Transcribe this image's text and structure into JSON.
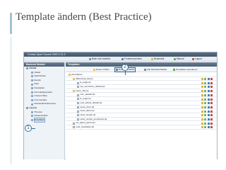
{
  "slide": {
    "title": "Template ändern (Best Practice)",
    "callouts": [
      "1",
      "2"
    ]
  },
  "app": {
    "title": "Contao Open Source CMS 2.11.3",
    "menu": [
      {
        "label": "Back end modules",
        "icon": "grid-icon",
        "color": "#7a8a99"
      },
      {
        "label": "Frontend preview",
        "icon": "preview-icon",
        "color": "#3f7fbf"
      },
      {
        "label": "Bookmark",
        "icon": "star-icon",
        "color": "#e2b33a"
      },
      {
        "label": "Manual",
        "icon": "help-icon",
        "color": "#5aa84a"
      },
      {
        "label": "Logout",
        "icon": "logout-icon",
        "color": "#c94a3a"
      }
    ],
    "sidebar": {
      "header": "Backend Module",
      "items": [
        {
          "label": "Inhalte",
          "type": "group"
        },
        {
          "label": "Artikel",
          "type": "item"
        },
        {
          "label": "Nachrichten",
          "type": "item"
        },
        {
          "label": "Events",
          "type": "item"
        },
        {
          "label": "FAQ",
          "type": "item"
        },
        {
          "label": "Newsletter",
          "type": "item"
        },
        {
          "label": "Formulargenerator",
          "type": "item"
        },
        {
          "label": "Content Slice",
          "type": "item"
        },
        {
          "label": "Kommentare",
          "type": "item"
        },
        {
          "label": "Download Dokumente",
          "type": "item"
        },
        {
          "label": "Layout",
          "type": "group"
        },
        {
          "label": "Themes",
          "type": "item"
        },
        {
          "label": "Seitenstruktur",
          "type": "item"
        },
        {
          "label": "Templates",
          "type": "item",
          "selected": true
        }
      ]
    },
    "content": {
      "header": "Templates",
      "toolbar": [
        {
          "label": "Neuer Ordner",
          "color": "#e8c05a"
        },
        {
          "label": "Neues Template",
          "color": "#3f7fbf",
          "highlight": true
        },
        {
          "label": "Alle Mehrfachhaltbar",
          "color": "#7a8a99"
        },
        {
          "label": "Templates exportieren",
          "color": "#5aa84a"
        }
      ],
      "files": [
        {
          "name": "[templates]",
          "type": "folder",
          "indent": 0,
          "actions": false
        },
        {
          "name": "dbkonzept_theme",
          "type": "folder",
          "indent": 1,
          "actions": true
        },
        {
          "name": "fe_page.tpl",
          "type": "file",
          "indent": 2,
          "actions": true
        },
        {
          "name": "nav_accordion_default.tpl",
          "type": "file",
          "indent": 2,
          "actions": true
        },
        {
          "name": "neuer_theme",
          "type": "folder",
          "indent": 1,
          "actions": true
        },
        {
          "name": "com_default.tpl",
          "type": "file",
          "indent": 2,
          "actions": true
        },
        {
          "name": "fe_page.tpl",
          "type": "file",
          "indent": 2,
          "actions": true
        },
        {
          "name": "mod_article_default.tpl",
          "type": "file",
          "indent": 2,
          "actions": true
        },
        {
          "name": "news_short.tpl",
          "type": "file",
          "indent": 2,
          "actions": true
        },
        {
          "name": "news_latest.tpl",
          "type": "file",
          "indent": 2,
          "actions": true
        },
        {
          "name": "news_simple.tpl",
          "type": "file",
          "indent": 2,
          "actions": true
        },
        {
          "name": "news_simple_jumbopost.tpl",
          "type": "file",
          "indent": 2,
          "actions": true
        },
        {
          "name": "rss_latest_jumbo.tpl",
          "type": "file",
          "indent": 1,
          "actions": true
        },
        {
          "name": "mod_newsletter.tpl",
          "type": "file",
          "indent": 1,
          "actions": true
        }
      ]
    }
  }
}
